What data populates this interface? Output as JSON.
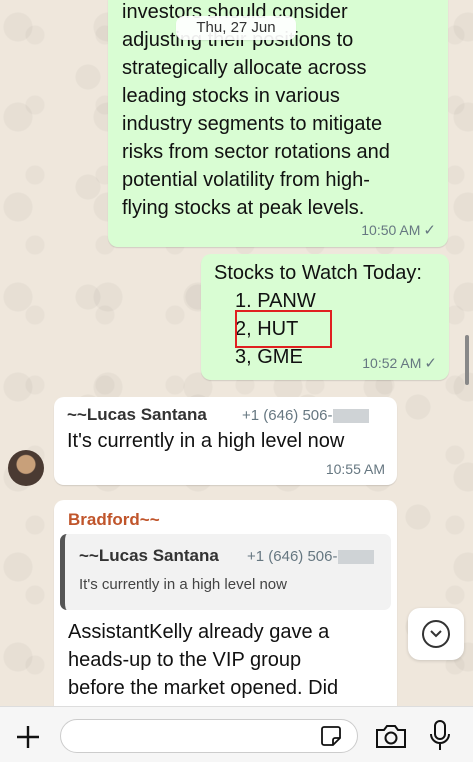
{
  "date_divider": "Thu, 27 Jun",
  "messages": {
    "out1": {
      "lines": [
        "investors should consider",
        "adjusting their positions to",
        "strategically allocate across",
        "leading stocks in various",
        "industry segments to mitigate",
        "risks from sector rotations and",
        "potential volatility from high-",
        "flying stocks at peak levels."
      ],
      "time": "10:50 AM"
    },
    "out2": {
      "title": "Stocks to Watch Today:",
      "items": [
        "1. PANW",
        "2, HUT",
        "3, GME"
      ],
      "time": "10:52 AM"
    },
    "in1": {
      "sender": "~~Lucas Santana",
      "phone": "+1 (646) 506-",
      "text": "It's currently in a high level now",
      "time": "10:55 AM"
    },
    "in2": {
      "sender": "Bradford~~",
      "quote_sender": "~~Lucas Santana",
      "quote_phone": "+1 (646) 506-",
      "quote_text": "It's currently in a high level now",
      "lines": [
        "AssistantKelly already gave a",
        "heads-up to the VIP group",
        "before the market opened. Did"
      ]
    }
  },
  "input": {
    "placeholder": ""
  },
  "colors": {
    "outgoing": "#d9fdd3",
    "incoming": "#ffffff",
    "sender_accent": "#c0552b",
    "highlight": "#e02020"
  },
  "icons": [
    "plus-icon",
    "sticker-icon",
    "camera-icon",
    "microphone-icon",
    "chevron-down-icon",
    "read-check-icon"
  ]
}
